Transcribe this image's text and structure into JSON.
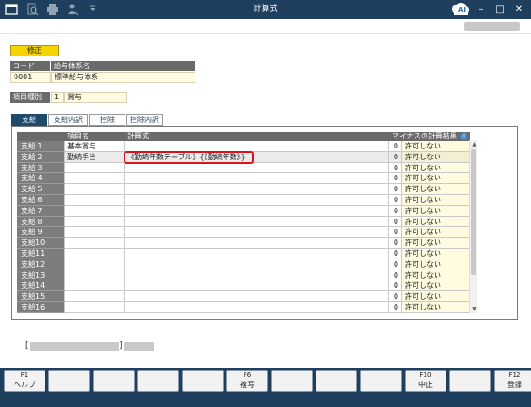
{
  "window": {
    "title": "計算式"
  },
  "toolbar": {
    "icons": [
      "window-icon",
      "search-icon",
      "print-icon",
      "person-icon",
      "dropdown-icon"
    ],
    "ai_label": "AI"
  },
  "mode_badge": "修正",
  "salary_system": {
    "code_header": "コード",
    "name_header": "給与体系名",
    "code": "0001",
    "name": "標準給与体系"
  },
  "item_kind": {
    "label": "項目種別",
    "code": "1",
    "name": "賞与"
  },
  "tabs": [
    {
      "label": "支給",
      "active": true
    },
    {
      "label": "支給内訳",
      "active": false
    },
    {
      "label": "控除",
      "active": false
    },
    {
      "label": "控除内訳",
      "active": false
    }
  ],
  "grid": {
    "headers": {
      "name": "項目名",
      "formula": "計算式",
      "minus": "マイナスの計算結果"
    },
    "rows": [
      {
        "label": "支給 1",
        "name": "基本賞与",
        "formula": "",
        "num": "0",
        "perm": "許可しない"
      },
      {
        "label": "支給 2",
        "name": "勤続手当",
        "formula": "《勤続年数テーブル》{《勤続年数》}",
        "num": "0",
        "perm": "許可しない"
      },
      {
        "label": "支給 3",
        "name": "",
        "formula": "",
        "num": "0",
        "perm": "許可しない"
      },
      {
        "label": "支給 4",
        "name": "",
        "formula": "",
        "num": "0",
        "perm": "許可しない"
      },
      {
        "label": "支給 5",
        "name": "",
        "formula": "",
        "num": "0",
        "perm": "許可しない"
      },
      {
        "label": "支給 6",
        "name": "",
        "formula": "",
        "num": "0",
        "perm": "許可しない"
      },
      {
        "label": "支給 7",
        "name": "",
        "formula": "",
        "num": "0",
        "perm": "許可しない"
      },
      {
        "label": "支給 8",
        "name": "",
        "formula": "",
        "num": "0",
        "perm": "許可しない"
      },
      {
        "label": "支給 9",
        "name": "",
        "formula": "",
        "num": "0",
        "perm": "許可しない"
      },
      {
        "label": "支給10",
        "name": "",
        "formula": "",
        "num": "0",
        "perm": "許可しない"
      },
      {
        "label": "支給11",
        "name": "",
        "formula": "",
        "num": "0",
        "perm": "許可しない"
      },
      {
        "label": "支給12",
        "name": "",
        "formula": "",
        "num": "0",
        "perm": "許可しない"
      },
      {
        "label": "支給13",
        "name": "",
        "formula": "",
        "num": "0",
        "perm": "許可しない"
      },
      {
        "label": "支給14",
        "name": "",
        "formula": "",
        "num": "0",
        "perm": "許可しない"
      },
      {
        "label": "支給15",
        "name": "",
        "formula": "",
        "num": "0",
        "perm": "許可しない"
      },
      {
        "label": "支給16",
        "name": "",
        "formula": "",
        "num": "0",
        "perm": "許可しない"
      }
    ]
  },
  "status": {
    "open": "[",
    "close": "]"
  },
  "function_keys": [
    {
      "key": "F1",
      "label": "ヘルプ"
    },
    {
      "key": "",
      "label": ""
    },
    {
      "key": "",
      "label": ""
    },
    {
      "key": "",
      "label": ""
    },
    {
      "key": "",
      "label": ""
    },
    {
      "key": "F6",
      "label": "複写"
    },
    {
      "key": "",
      "label": ""
    },
    {
      "key": "",
      "label": ""
    },
    {
      "key": "",
      "label": ""
    },
    {
      "key": "F10",
      "label": "中止"
    },
    {
      "key": "",
      "label": ""
    },
    {
      "key": "F12",
      "label": "登録"
    }
  ],
  "colors": {
    "titlebar": "#1e3f5d",
    "badge": "#f6d400",
    "highlight": "#d8141d",
    "input_bg": "#fffbe0"
  }
}
